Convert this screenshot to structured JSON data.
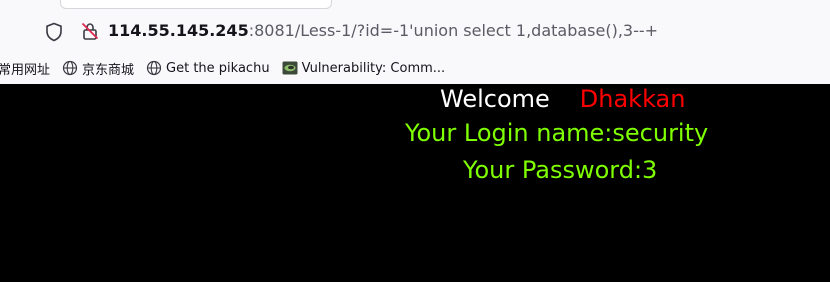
{
  "browser": {
    "url_host": "114.55.145.245",
    "url_rest": ":8081/Less-1/?id=-1'union select 1,database(),3--+"
  },
  "bookmarks": {
    "items": [
      {
        "label": "常用网址",
        "icon": "none"
      },
      {
        "label": "京东商城",
        "icon": "globe-icon"
      },
      {
        "label": "Get the pikachu",
        "icon": "globe-icon"
      },
      {
        "label": "Vulnerability: Comm...",
        "icon": "dvwa-icon"
      }
    ]
  },
  "page": {
    "welcome_word": "Welcome",
    "welcome_name": "Dhakkan",
    "login_text": "Your Login name:security",
    "password_text": "Your Password:3"
  },
  "colors": {
    "background": "#000000",
    "welcome": "#ffffff",
    "name": "#ff0000",
    "result": "#7fff00"
  }
}
